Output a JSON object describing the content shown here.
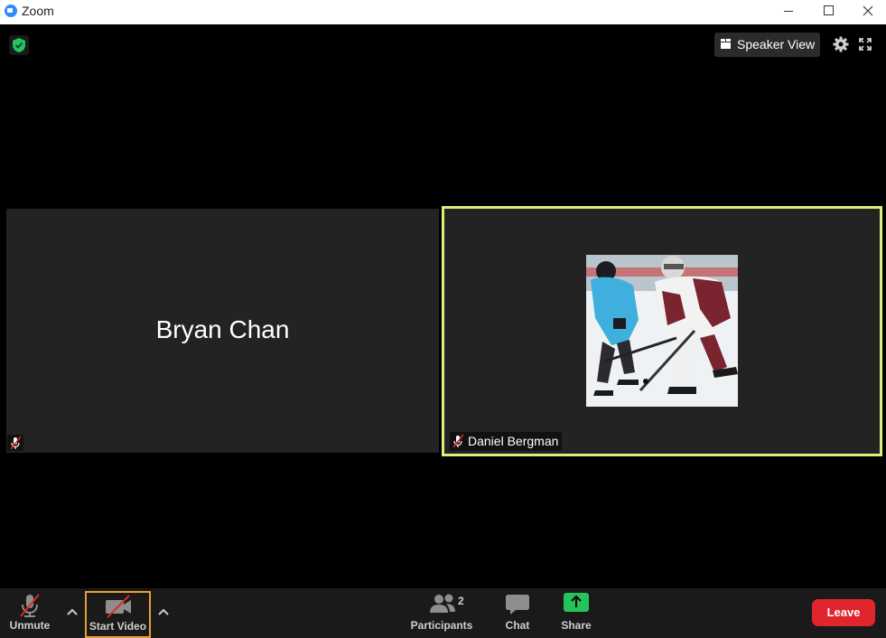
{
  "window": {
    "title": "Zoom"
  },
  "meeting": {
    "view_mode_label": "Speaker View"
  },
  "participants": [
    {
      "name": "Bryan Chan",
      "muted": true,
      "video": false
    },
    {
      "name": "Daniel Bergman",
      "muted": true,
      "video": false,
      "active_speaker": true
    }
  ],
  "toolbar": {
    "unmute_label": "Unmute",
    "start_video_label": "Start Video",
    "participants_label": "Participants",
    "participants_count": "2",
    "chat_label": "Chat",
    "share_label": "Share",
    "leave_label": "Leave"
  },
  "colors": {
    "active_speaker_border": "#d9f07a",
    "leave_button": "#e0262c",
    "share_button": "#23c45c",
    "focus_outline": "#e8a033",
    "brand": "#2d8cff"
  }
}
